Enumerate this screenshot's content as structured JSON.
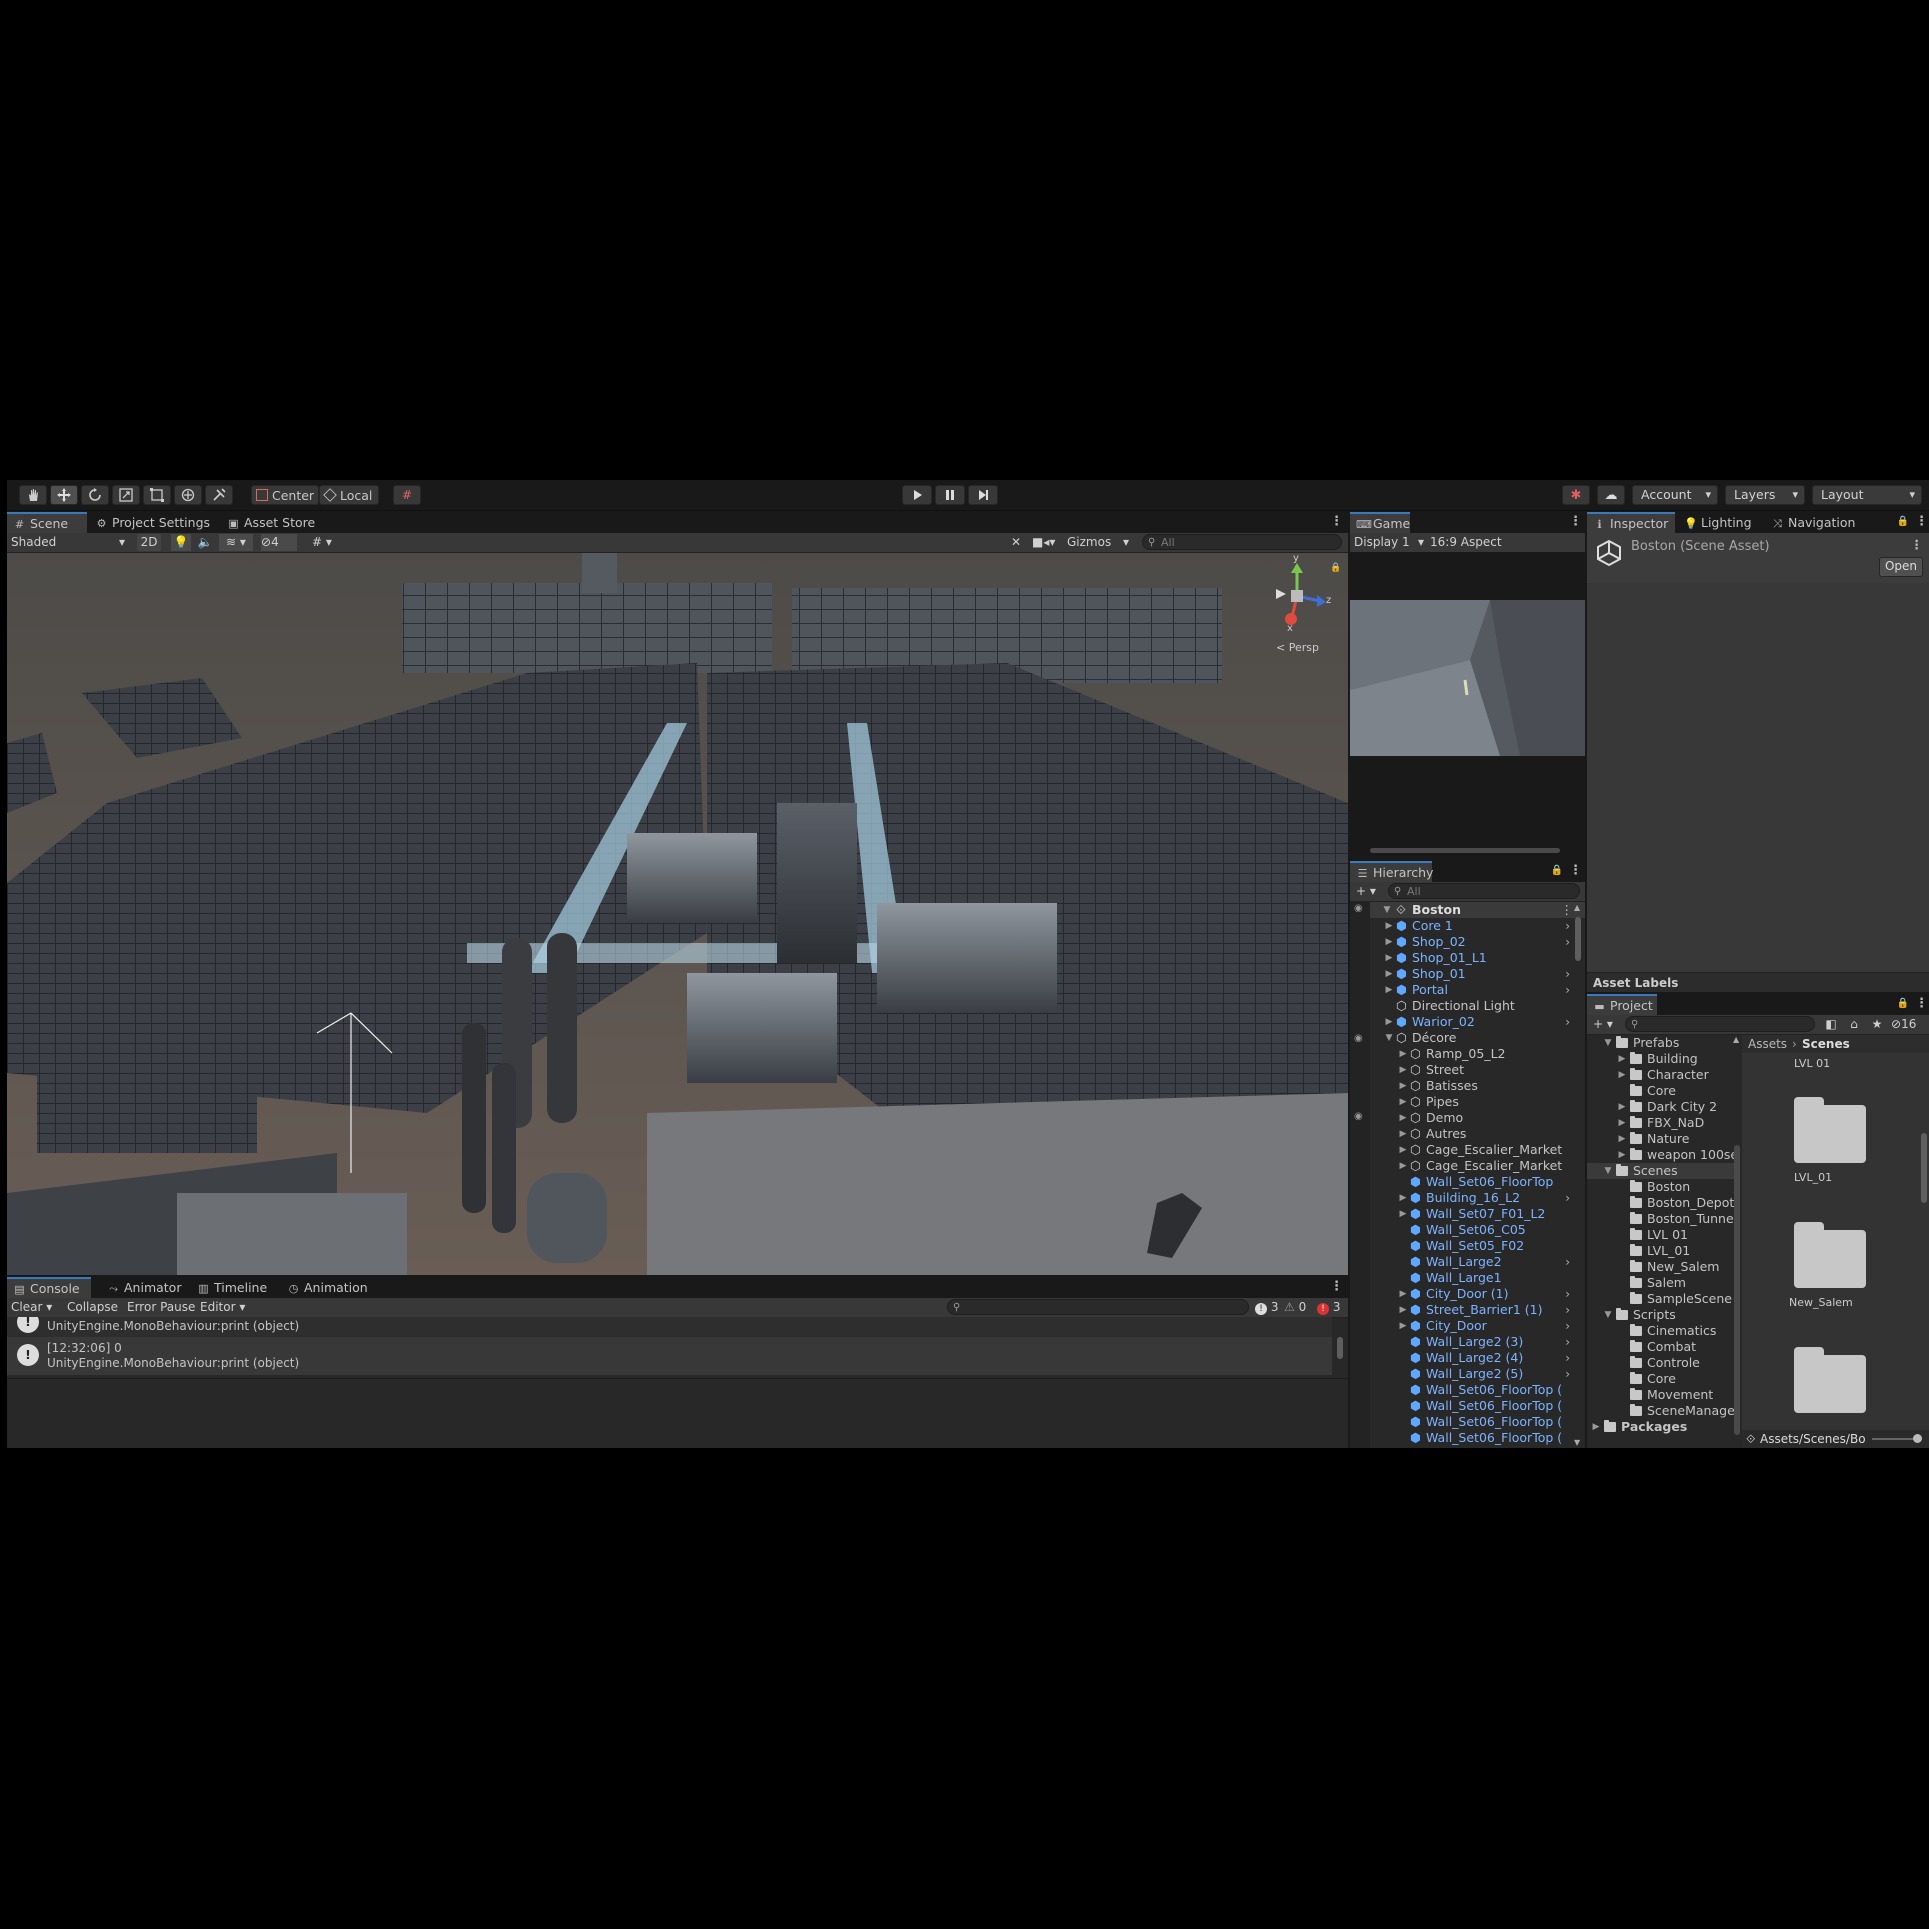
{
  "toolbar": {
    "pivot_center": "Center",
    "pivot_local": "Local",
    "account": "Account",
    "layers": "Layers",
    "layout": "Layout"
  },
  "scene": {
    "tabs": [
      "Scene",
      "Project Settings",
      "Asset Store"
    ],
    "draw_mode": "Shaded",
    "mode_2d": "2D",
    "hidden_count": "4",
    "gizmos": "Gizmos",
    "search_placeholder": "All",
    "gizmo_axes": {
      "y": "y",
      "z": "z",
      "x": "x"
    },
    "persp": "< Persp"
  },
  "game": {
    "tab": "Game",
    "display": "Display 1",
    "aspect": "16:9 Aspect"
  },
  "hierarchy": {
    "tab": "Hierarchy",
    "search_placeholder": "All",
    "root": "Boston",
    "items": [
      {
        "label": "Core 1",
        "depth": 1,
        "prefab": true,
        "expand": "closed",
        "chev": true
      },
      {
        "label": "Shop_02",
        "depth": 1,
        "prefab": true,
        "expand": "closed",
        "chev": true
      },
      {
        "label": "Shop_01_L1",
        "depth": 1,
        "prefab": true,
        "expand": "closed",
        "chev": false
      },
      {
        "label": "Shop_01",
        "depth": 1,
        "prefab": true,
        "expand": "closed",
        "chev": true
      },
      {
        "label": "Portal",
        "depth": 1,
        "prefab": true,
        "expand": "closed",
        "chev": true
      },
      {
        "label": "Directional Light",
        "depth": 1,
        "prefab": false,
        "expand": "none",
        "chev": false
      },
      {
        "label": "Warior_02",
        "depth": 1,
        "prefab": true,
        "expand": "closed",
        "chev": true
      },
      {
        "label": "Décore",
        "depth": 1,
        "prefab": false,
        "expand": "open",
        "chev": false
      },
      {
        "label": "Ramp_05_L2",
        "depth": 2,
        "prefab": false,
        "expand": "closed",
        "chev": false
      },
      {
        "label": "Street",
        "depth": 2,
        "prefab": false,
        "expand": "closed",
        "chev": false
      },
      {
        "label": "Batisses",
        "depth": 2,
        "prefab": false,
        "expand": "closed",
        "chev": false
      },
      {
        "label": "Pipes",
        "depth": 2,
        "prefab": false,
        "expand": "closed",
        "chev": false
      },
      {
        "label": "Demo",
        "depth": 2,
        "prefab": false,
        "expand": "closed",
        "chev": false
      },
      {
        "label": "Autres",
        "depth": 2,
        "prefab": false,
        "expand": "closed",
        "chev": false
      },
      {
        "label": "Cage_Escalier_Market",
        "depth": 2,
        "prefab": false,
        "expand": "closed",
        "chev": false
      },
      {
        "label": "Cage_Escalier_Market",
        "depth": 2,
        "prefab": false,
        "expand": "closed",
        "chev": false
      },
      {
        "label": "Wall_Set06_FloorTop",
        "depth": 2,
        "prefab": true,
        "expand": "none",
        "chev": false
      },
      {
        "label": "Building_16_L2",
        "depth": 2,
        "prefab": true,
        "expand": "closed",
        "chev": true
      },
      {
        "label": "Wall_Set07_F01_L2",
        "depth": 2,
        "prefab": true,
        "expand": "closed",
        "chev": false
      },
      {
        "label": "Wall_Set06_C05",
        "depth": 2,
        "prefab": true,
        "expand": "none",
        "chev": false
      },
      {
        "label": "Wall_Set05_F02",
        "depth": 2,
        "prefab": true,
        "expand": "none",
        "chev": false
      },
      {
        "label": "Wall_Large2",
        "depth": 2,
        "prefab": true,
        "expand": "none",
        "chev": true
      },
      {
        "label": "Wall_Large1",
        "depth": 2,
        "prefab": true,
        "expand": "none",
        "chev": false
      },
      {
        "label": "City_Door (1)",
        "depth": 2,
        "prefab": true,
        "expand": "closed",
        "chev": true
      },
      {
        "label": "Street_Barrier1 (1)",
        "depth": 2,
        "prefab": true,
        "expand": "closed",
        "chev": true
      },
      {
        "label": "City_Door",
        "depth": 2,
        "prefab": true,
        "expand": "closed",
        "chev": true
      },
      {
        "label": "Wall_Large2 (3)",
        "depth": 2,
        "prefab": true,
        "expand": "none",
        "chev": true
      },
      {
        "label": "Wall_Large2 (4)",
        "depth": 2,
        "prefab": true,
        "expand": "none",
        "chev": true
      },
      {
        "label": "Wall_Large2 (5)",
        "depth": 2,
        "prefab": true,
        "expand": "none",
        "chev": true
      },
      {
        "label": "Wall_Set06_FloorTop (",
        "depth": 2,
        "prefab": true,
        "expand": "none",
        "chev": false
      },
      {
        "label": "Wall_Set06_FloorTop (",
        "depth": 2,
        "prefab": true,
        "expand": "none",
        "chev": false
      },
      {
        "label": "Wall_Set06_FloorTop (",
        "depth": 2,
        "prefab": true,
        "expand": "none",
        "chev": false
      },
      {
        "label": "Wall_Set06_FloorTop (",
        "depth": 2,
        "prefab": true,
        "expand": "none",
        "chev": false
      }
    ]
  },
  "inspector": {
    "tabs": [
      "Inspector",
      "Lighting",
      "Navigation"
    ],
    "title": "Boston (Scene Asset)",
    "open_button": "Open",
    "asset_labels": "Asset Labels"
  },
  "project": {
    "tab": "Project",
    "hidden_count": "16",
    "breadcrumb": [
      "Assets",
      "Scenes"
    ],
    "tree": [
      {
        "label": "Prefabs",
        "depth": 1,
        "expand": "open"
      },
      {
        "label": "Building",
        "depth": 2,
        "expand": "closed"
      },
      {
        "label": "Character",
        "depth": 2,
        "expand": "closed"
      },
      {
        "label": "Core",
        "depth": 2,
        "expand": "none"
      },
      {
        "label": "Dark City 2",
        "depth": 2,
        "expand": "closed"
      },
      {
        "label": "FBX_NaD",
        "depth": 2,
        "expand": "closed"
      },
      {
        "label": "Nature",
        "depth": 2,
        "expand": "closed"
      },
      {
        "label": "weapon 100se",
        "depth": 2,
        "expand": "closed"
      },
      {
        "label": "Scenes",
        "depth": 1,
        "expand": "open",
        "selected": true
      },
      {
        "label": "Boston",
        "depth": 2,
        "expand": "none"
      },
      {
        "label": "Boston_Depot",
        "depth": 2,
        "expand": "none"
      },
      {
        "label": "Boston_Tunne",
        "depth": 2,
        "expand": "none"
      },
      {
        "label": "LVL 01",
        "depth": 2,
        "expand": "none"
      },
      {
        "label": "LVL_01",
        "depth": 2,
        "expand": "none"
      },
      {
        "label": "New_Salem",
        "depth": 2,
        "expand": "none"
      },
      {
        "label": "Salem",
        "depth": 2,
        "expand": "none"
      },
      {
        "label": "SampleScene",
        "depth": 2,
        "expand": "none"
      },
      {
        "label": "Scripts",
        "depth": 1,
        "expand": "open"
      },
      {
        "label": "Cinematics",
        "depth": 2,
        "expand": "none"
      },
      {
        "label": "Combat",
        "depth": 2,
        "expand": "none"
      },
      {
        "label": "Controle",
        "depth": 2,
        "expand": "none"
      },
      {
        "label": "Core",
        "depth": 2,
        "expand": "none"
      },
      {
        "label": "Movement",
        "depth": 2,
        "expand": "none"
      },
      {
        "label": "SceneManage",
        "depth": 2,
        "expand": "none"
      },
      {
        "label": "Packages",
        "depth": 0,
        "expand": "closed",
        "bold": true
      }
    ],
    "grid": [
      "LVL 01",
      "LVL_01",
      "New_Salem"
    ],
    "path": "Assets/Scenes/Bo"
  },
  "console": {
    "tabs": [
      "Console",
      "Animator",
      "Timeline",
      "Animation"
    ],
    "clear": "Clear",
    "collapse": "Collapse",
    "error_pause": "Error Pause",
    "editor": "Editor",
    "log_count": "3",
    "warn_count": "0",
    "error_count": "3",
    "entries": [
      {
        "line1": "",
        "line2": "UnityEngine.MonoBehaviour:print (object)"
      },
      {
        "line1": "[12:32:06] 0",
        "line2": "UnityEngine.MonoBehaviour:print (object)"
      }
    ]
  }
}
